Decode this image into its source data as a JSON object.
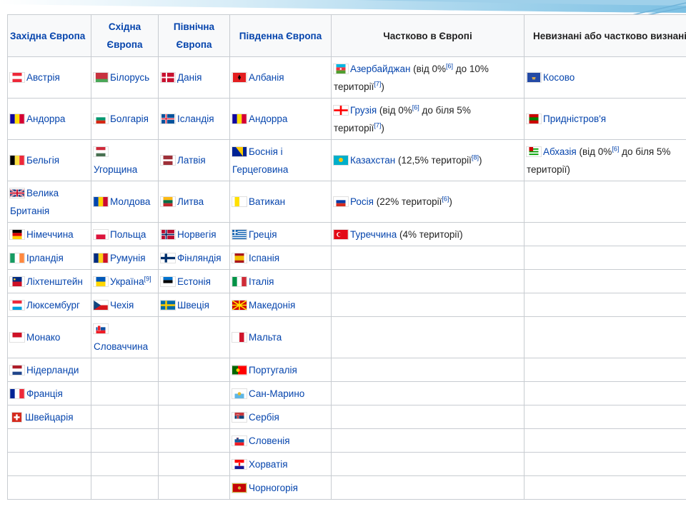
{
  "headers": {
    "western": "Західна Європа",
    "eastern": "Східна Європа",
    "northern": "Північна Європа",
    "southern": "Південна Європа",
    "partial": "Частково в Європі",
    "unrecognized": "Невизнані або частково визнані"
  },
  "western": [
    "Австрія",
    "Андорра",
    "Бельгія",
    "Велика Британія",
    "Німеччина",
    "Ірландія",
    "Ліхтенштейн",
    "Люксембург",
    "Монако",
    "Нідерланди",
    "Франція",
    "Швейцарія"
  ],
  "eastern": [
    "Білорусь",
    "Болгарія",
    "Угорщина",
    "Молдова",
    "Польща",
    "Румунія",
    "Україна",
    "Чехія",
    "Словаччина"
  ],
  "eastern_ukraine_ref": "[9]",
  "northern": [
    "Данія",
    "Ісландія",
    "Латвія",
    "Литва",
    "Норвегія",
    "Фінляндія",
    "Естонія",
    "Швеція"
  ],
  "southern": [
    "Албанія",
    "Андорра",
    "Боснія і Герцеговина",
    "Ватикан",
    "Греція",
    "Іспанія",
    "Італія",
    "Македонія",
    "Мальта",
    "Португалія",
    "Сан-Марино",
    "Сербія",
    "Словенія",
    "Хорватія",
    "Чорногорія"
  ],
  "partial": [
    {
      "name": "Азербайджан",
      "pre": " (від 0%",
      "ref1": "[6]",
      "mid": " до 10% території",
      "ref2": "[7]",
      "post": ")"
    },
    {
      "name": "Грузія",
      "pre": " (від 0%",
      "ref1": "[6]",
      "mid": " до біля 5% території",
      "ref2": "[7]",
      "post": ")"
    },
    {
      "name": "Казахстан",
      "pre": " (12,5% території",
      "ref1": "[8]",
      "mid": ")",
      "ref2": "",
      "post": ""
    },
    {
      "name": "Росія",
      "pre": " (22% території",
      "ref1": "[6]",
      "mid": ")",
      "ref2": "",
      "post": ""
    },
    {
      "name": "Туреччина",
      "pre": " (4% території)",
      "ref1": "",
      "mid": "",
      "ref2": "",
      "post": ""
    }
  ],
  "unrecognized": [
    {
      "name": "Косово",
      "pre": "",
      "ref1": "",
      "mid": ""
    },
    {
      "name": "Придністров'я",
      "pre": "",
      "ref1": "",
      "mid": ""
    },
    {
      "name": "Абхазія",
      "pre": " (від 0%",
      "ref1": "[6]",
      "mid": " до біля 5% території)"
    }
  ],
  "colors": {
    "link": "#0645ad",
    "border": "#c8ccd1",
    "header_bg": "#f8f9fa",
    "decor": "#6fb3d9"
  }
}
